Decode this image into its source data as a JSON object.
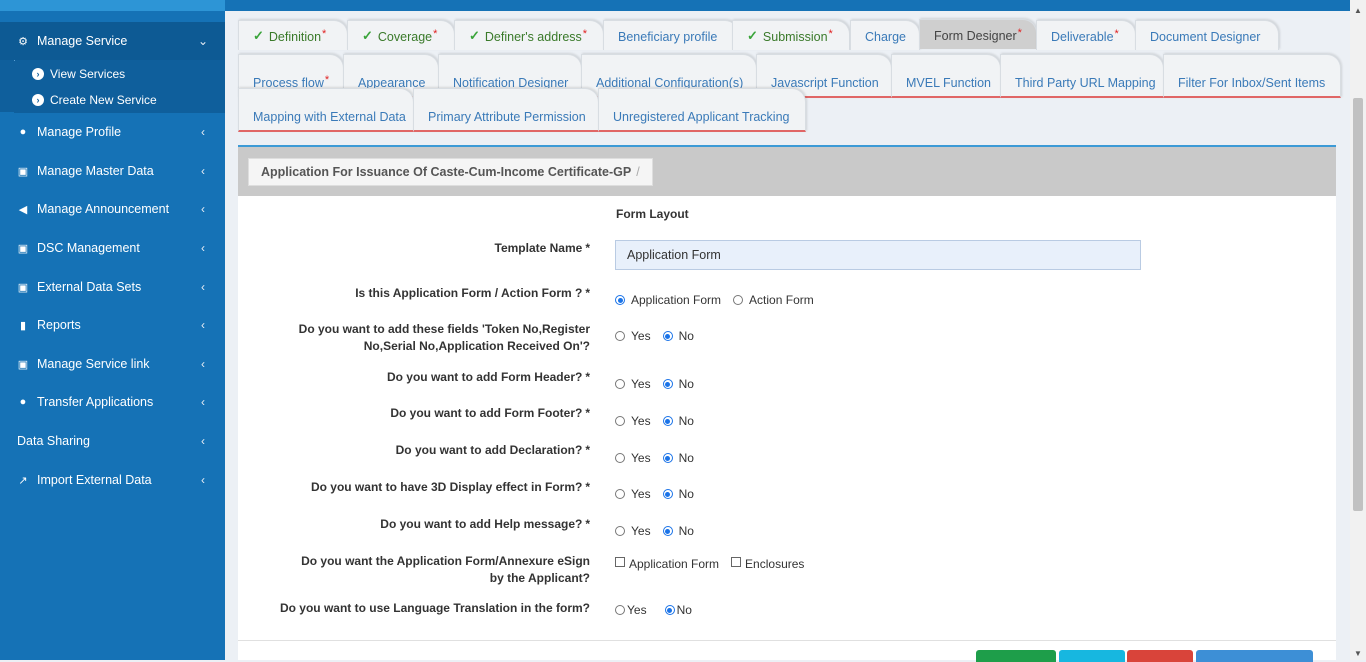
{
  "sidebar": {
    "items": [
      {
        "label": "Manage Service",
        "icon": "cogs-icon",
        "glyph": "⚙",
        "chev": "⌄"
      },
      {
        "label": "Manage Profile",
        "icon": "users-icon",
        "glyph": "👥",
        "chev": "‹"
      },
      {
        "label": "Manage Master Data",
        "icon": "laptop-icon",
        "glyph": "💻",
        "chev": "‹"
      },
      {
        "label": "Manage Announcement",
        "icon": "bullhorn-icon",
        "glyph": "📢",
        "chev": "‹"
      },
      {
        "label": "DSC Management",
        "icon": "module-icon",
        "glyph": "▣",
        "chev": "‹"
      },
      {
        "label": "External Data Sets",
        "icon": "module-icon",
        "glyph": "▣",
        "chev": "‹"
      },
      {
        "label": "Reports",
        "icon": "file-icon",
        "glyph": "🗎",
        "chev": "‹"
      },
      {
        "label": "Manage Service link",
        "icon": "module-icon",
        "glyph": "▣",
        "chev": "‹"
      },
      {
        "label": "Transfer Applications",
        "icon": "users-icon",
        "glyph": "👥",
        "chev": "‹"
      },
      {
        "label": "Data Sharing",
        "icon": "",
        "glyph": "",
        "chev": "‹"
      },
      {
        "label": "Import External Data",
        "icon": "external-link-icon",
        "glyph": "↗",
        "chev": "‹"
      }
    ],
    "subitems": [
      {
        "label": "View Services"
      },
      {
        "label": "Create New Service"
      }
    ]
  },
  "tabs": {
    "row1": [
      {
        "label": "Definition",
        "done": true,
        "required": true
      },
      {
        "label": "Coverage",
        "done": true,
        "required": true
      },
      {
        "label": "Definer's address",
        "done": true,
        "required": true
      },
      {
        "label": "Beneficiary profile",
        "done": false,
        "required": false
      },
      {
        "label": "Submission",
        "done": true,
        "required": true
      },
      {
        "label": "Charge",
        "done": false,
        "required": false
      },
      {
        "label": "Form Designer",
        "done": false,
        "required": true,
        "active": true
      },
      {
        "label": "Deliverable",
        "done": false,
        "required": true
      },
      {
        "label": "Document Designer",
        "done": false,
        "required": false
      }
    ],
    "row2": [
      {
        "label": "Process flow",
        "required": true
      },
      {
        "label": "Appearance",
        "required": false
      },
      {
        "label": "Notification Designer",
        "required": false
      },
      {
        "label": "Additional Configuration(s)",
        "required": false
      },
      {
        "label": "Javascript Function",
        "required": false
      },
      {
        "label": "MVEL Function",
        "required": false
      },
      {
        "label": "Third Party URL Mapping",
        "required": false
      },
      {
        "label": "Filter For Inbox/Sent Items",
        "required": false
      }
    ],
    "row3": [
      {
        "label": "Mapping with External Data"
      },
      {
        "label": "Primary Attribute Permission"
      },
      {
        "label": "Unregistered Applicant Tracking"
      }
    ],
    "required_mark": "*",
    "check_mark": "✓"
  },
  "breadcrumb": {
    "title": "Application For Issuance Of Caste-Cum-Income Certificate-GP",
    "sep": "/"
  },
  "form": {
    "section_title": "Form Layout",
    "template_name_label": "Template Name",
    "template_name_value": "Application Form",
    "star": "*",
    "q_app_action": "Is this Application Form / Action Form ?",
    "opt_application_form": "Application Form",
    "opt_action_form": "Action Form",
    "q_token": "Do you want to add these fields 'Token No,Register No,Serial No,Application Received On'?",
    "q_header": "Do you want to add Form Header?",
    "q_footer": "Do you want to add Form Footer?",
    "q_declaration": "Do you want to add Declaration?",
    "q_3d": "Do you want to have 3D Display effect in Form?",
    "q_help": "Do you want to add Help message?",
    "q_esign": "Do you want the Application Form/Annexure eSign by the Applicant?",
    "q_language": "Do you want to use Language Translation in the form?",
    "yes": "Yes",
    "no": "No",
    "esign_application_form": "Application Form",
    "esign_enclosures": "Enclosures"
  },
  "colors": {
    "sidebar": "#1572b6",
    "accent": "#3c9ad6",
    "btn_green": "#1e9e4a",
    "btn_cyan": "#17b7e0",
    "btn_red": "#d9443a",
    "btn_blue": "#3d8fd6"
  }
}
